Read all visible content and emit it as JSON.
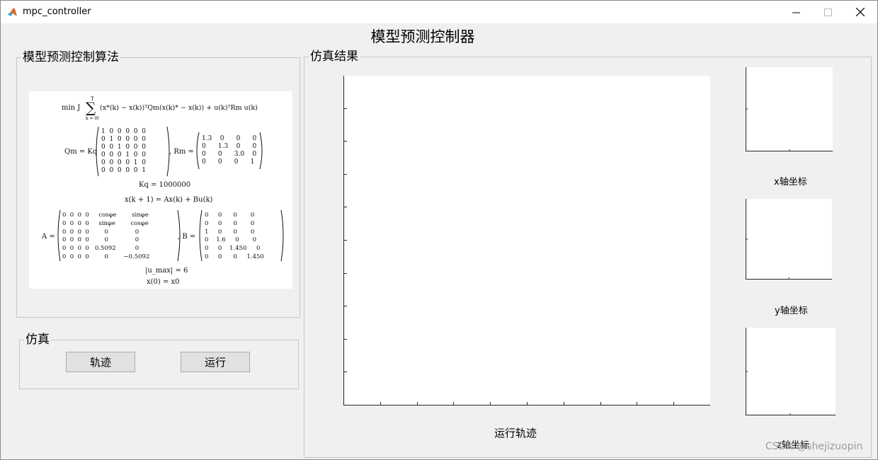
{
  "window": {
    "title": "mpc_controller",
    "controls": {
      "minimize": "minimize-icon",
      "maximize": "maximize-icon",
      "close": "close-icon"
    }
  },
  "app": {
    "title": "模型预测控制器"
  },
  "algorithm_panel": {
    "label": "模型预测控制算法",
    "formula": {
      "objective_left": "min J",
      "sum_top": "T",
      "sum_symbol": "∑",
      "sum_bottom": "k = t0",
      "objective_right": "(x*(k) − x(k))ᵀQm(x(k)* − x(k)) + u(k)ᵀRm u(k)",
      "qm_lhs": "Qm = Kq",
      "qm_rows": [
        "1  0  0  0  0  0",
        "0  1  0  0  0  0",
        "0  0  1  0  0  0",
        "0  0  0  1  0  0",
        "0  0  0  0  1  0",
        "0  0  0  0  0  1"
      ],
      "rm_lhs": ", Rm =",
      "rm_rows": [
        "1.3    0      0      0",
        "0      1.3    0      0",
        "0      0      3.0    0",
        "0      0      0      1"
      ],
      "kq": "Kq = 1000000",
      "state_eq": "x(k + 1) = Ax(k) + Bu(k)",
      "a_lhs": "A =",
      "a_rows": [
        "0  0  0  0     cosφe        sinφe",
        "0  0  0  0     sinφe        cosφe",
        "0  0  0  0        0              0",
        "0  0  0  0        0              0",
        "0  0  0  0   0.5092          0",
        "0  0  0  0        0        −0.5092"
      ],
      "b_lhs": ", B =",
      "b_rows": [
        "0     0      0       0",
        "0     0      0       0",
        "1     0      0       0",
        "0    1.6     0       0",
        "0     0    1.450     0",
        "0     0      0     1.450"
      ],
      "constraint": "|u_max| = 6",
      "initial": "x(0) = x0"
    }
  },
  "sim_panel": {
    "label": "仿真",
    "buttons": {
      "trajectory": "轨迹",
      "run": "运行"
    }
  },
  "results_panel": {
    "label": "仿真结果",
    "main_axes_caption": "运行轨迹",
    "x_axes_caption": "x轴坐标",
    "y_axes_caption": "y轴坐标",
    "z_axes_caption": "z轴坐标"
  },
  "watermark": "CSDN @shejizuopin"
}
